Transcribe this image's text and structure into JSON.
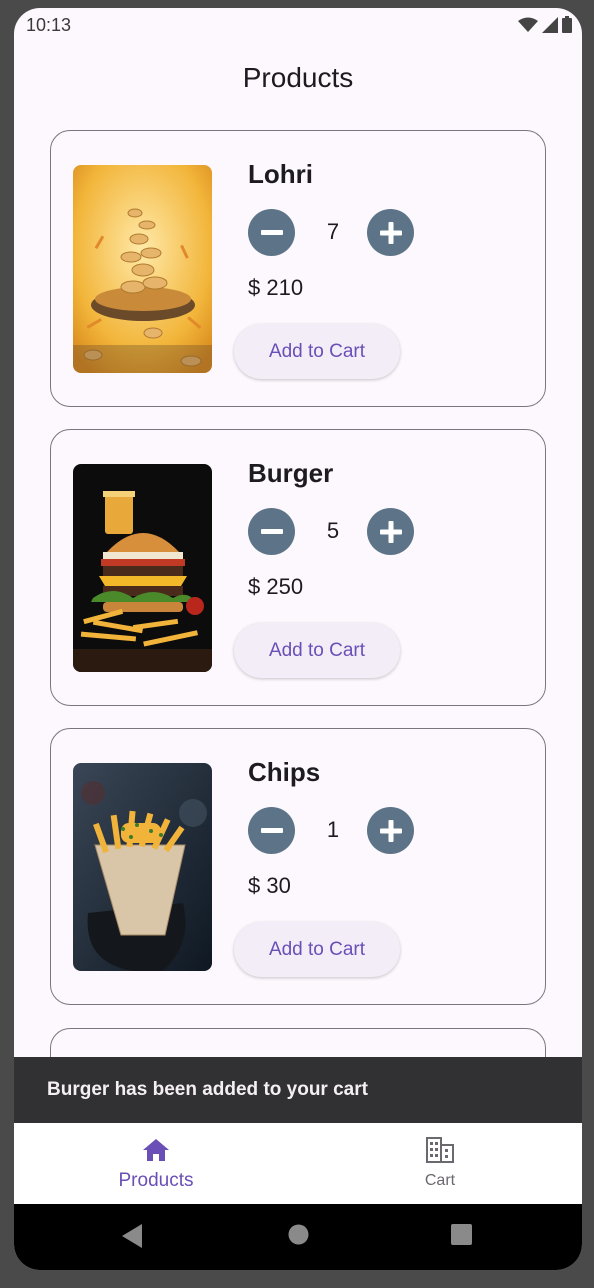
{
  "status_bar": {
    "time": "10:13"
  },
  "page": {
    "title": "Products"
  },
  "products": [
    {
      "name": "Lohri",
      "quantity": "7",
      "price": "$ 210",
      "add_label": "Add to Cart"
    },
    {
      "name": "Burger",
      "quantity": "5",
      "price": "$ 250",
      "add_label": "Add to Cart"
    },
    {
      "name": "Chips",
      "quantity": "1",
      "price": "$ 30",
      "add_label": "Add to Cart"
    }
  ],
  "snackbar": {
    "message": "Burger has been added to your cart"
  },
  "bottom_nav": {
    "items": [
      {
        "label": "Products",
        "icon": "home-icon",
        "active": true
      },
      {
        "label": "Cart",
        "icon": "building-icon",
        "active": false
      }
    ]
  },
  "colors": {
    "accent": "#6a4fb7",
    "qty_button": "#5c7388",
    "background": "#fdf8fd",
    "snackbar": "#313033"
  }
}
